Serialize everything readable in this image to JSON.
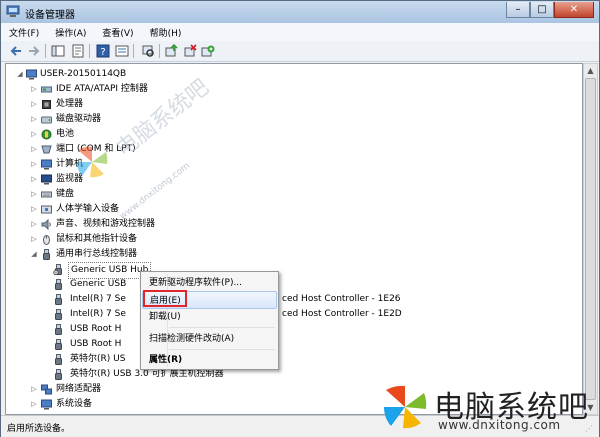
{
  "window": {
    "title": "设备管理器",
    "min": "–",
    "max": "□",
    "close": "✕"
  },
  "menu": [
    "文件(F)",
    "操作(A)",
    "查看(V)",
    "帮助(H)"
  ],
  "tree": {
    "root": "USER-20150114QB",
    "items": [
      {
        "label": "IDE ATA/ATAPI 控制器",
        "icon": "ide-controller-icon"
      },
      {
        "label": "处理器",
        "icon": "processor-icon"
      },
      {
        "label": "磁盘驱动器",
        "icon": "disk-drive-icon"
      },
      {
        "label": "电池",
        "icon": "battery-icon"
      },
      {
        "label": "端口 (COM 和 LPT)",
        "icon": "port-icon"
      },
      {
        "label": "计算机",
        "icon": "computer-icon"
      },
      {
        "label": "监视器",
        "icon": "monitor-icon"
      },
      {
        "label": "键盘",
        "icon": "keyboard-icon"
      },
      {
        "label": "人体学输入设备",
        "icon": "hid-icon"
      },
      {
        "label": "声音、视频和游戏控制器",
        "icon": "sound-icon"
      },
      {
        "label": "鼠标和其他指针设备",
        "icon": "mouse-icon"
      },
      {
        "label": "通用串行总线控制器",
        "icon": "usb-icon"
      }
    ],
    "usb_children": [
      "Generic USB Hub",
      "Generic USB",
      "Intel(R) 7 Se",
      "Intel(R) 7 Se",
      "USB Root H",
      "USB Root H",
      "英特尔(R) US",
      "英特尔(R) USB 3.0 可扩展主机控制器"
    ],
    "tail_col1": "ced Host Controller - 1E26",
    "tail_col2": "ced Host Controller - 1E2D",
    "after": [
      {
        "label": "网络适配器",
        "icon": "network-adapter-icon"
      },
      {
        "label": "系统设备",
        "icon": "system-device-icon"
      }
    ]
  },
  "context_menu": [
    {
      "label": "更新驱动程序软件(P)..."
    },
    {
      "label": "启用(E)"
    },
    {
      "label": "卸载(U)"
    },
    {
      "label": "扫描检测硬件改动(A)"
    },
    {
      "label": "属性(R)"
    }
  ],
  "status": "启用所选设备。",
  "watermark": {
    "text": "电脑系统吧",
    "url": "www.dnxitong.com"
  },
  "brand": {
    "name": "电脑系统吧",
    "url": "www.dnxitong.com"
  },
  "colors": {
    "highlight_box": "#e0272b",
    "logo_red": "#e84a1c",
    "logo_green": "#7dbb2c",
    "logo_blue": "#1aa3e8",
    "logo_yellow": "#f7b500"
  }
}
